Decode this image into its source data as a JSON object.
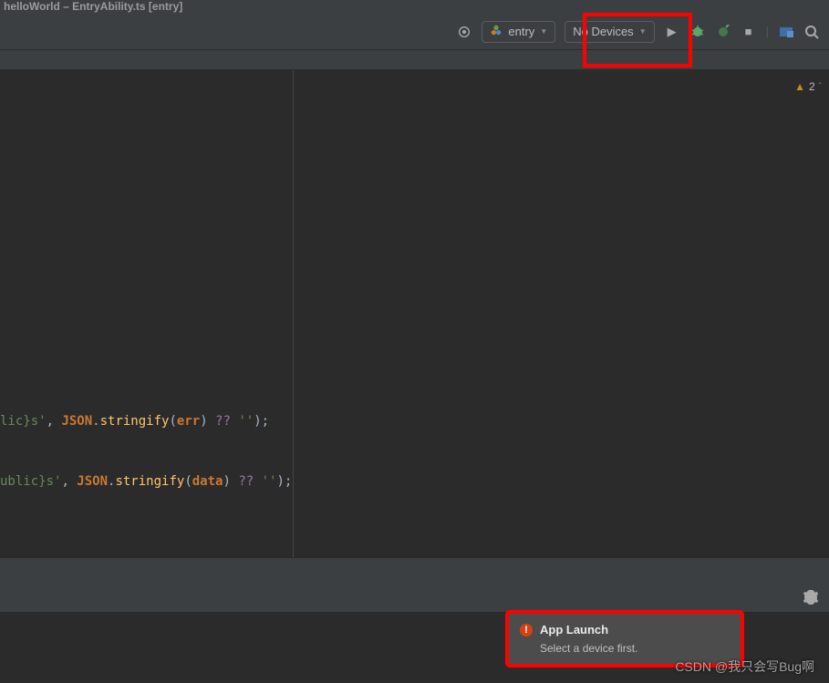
{
  "title": "helloWorld – EntryAbility.ts [entry]",
  "toolbar": {
    "module_label": "entry",
    "devices_label": "No Devices"
  },
  "inspection": {
    "warning_count": "2"
  },
  "code": {
    "line1": {
      "s1": "lic}s'",
      "s2": ", ",
      "s3": "JSON",
      "s4": ".",
      "s5": "stringify",
      "s6": "(",
      "s7": "err",
      "s8": ") ",
      "s9": "?? ",
      "s10": "''",
      "s11": ");"
    },
    "line2": {
      "s1": "ublic}s'",
      "s2": ", ",
      "s3": "JSON",
      "s4": ".",
      "s5": "stringify",
      "s6": "(",
      "s7": "data",
      "s8": ") ",
      "s9": "?? ",
      "s10": "''",
      "s11": ");"
    }
  },
  "toast": {
    "title": "App Launch",
    "message": "Select a device first."
  },
  "watermark": "CSDN @我只会写Bug啊"
}
